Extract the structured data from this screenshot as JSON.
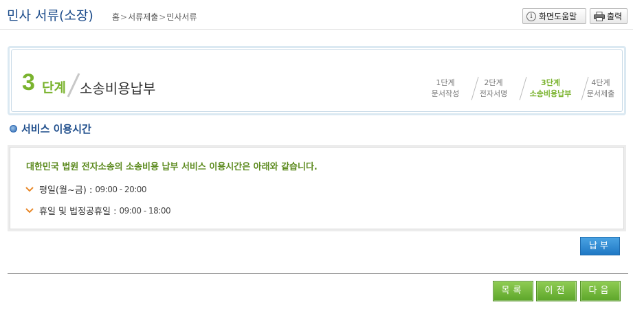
{
  "header": {
    "title": "민사 서류(소장)",
    "breadcrumb": [
      "홈",
      "서류제출",
      "민사서류"
    ],
    "breadcrumb_sep": ">",
    "help_label": "화면도움말",
    "print_label": "출력"
  },
  "step": {
    "number": "3",
    "word": "단계",
    "title": "소송비용납부",
    "items": [
      {
        "line1": "1단계",
        "line2": "문서작성"
      },
      {
        "line1": "2단계",
        "line2": "전자서명"
      },
      {
        "line1": "3단계",
        "line2": "소송비용납부"
      },
      {
        "line1": "4단계",
        "line2": "문서제출"
      }
    ],
    "active_index": 2
  },
  "section": {
    "title": "서비스 이용시간"
  },
  "info": {
    "lead": "대한민국 법원 전자소송의 소송비용 납부 서비스 이용시간은 아래와 같습니다.",
    "rows": [
      {
        "label": "평일(월~금) :",
        "time": "09:00 - 20:00"
      },
      {
        "label": "휴일 및 법정공휴일 :",
        "time": "09:00 - 18:00"
      }
    ]
  },
  "buttons": {
    "pay": "납부",
    "list": "목록",
    "prev": "이전",
    "next": "다음"
  },
  "colors": {
    "title_blue": "#1f4e8c",
    "step_green": "#7ab32e",
    "lead_green": "#5c8a1e",
    "pay_blue": "#1f78c4",
    "button_green": "#5da62a",
    "chevron_orange": "#e8892b"
  }
}
